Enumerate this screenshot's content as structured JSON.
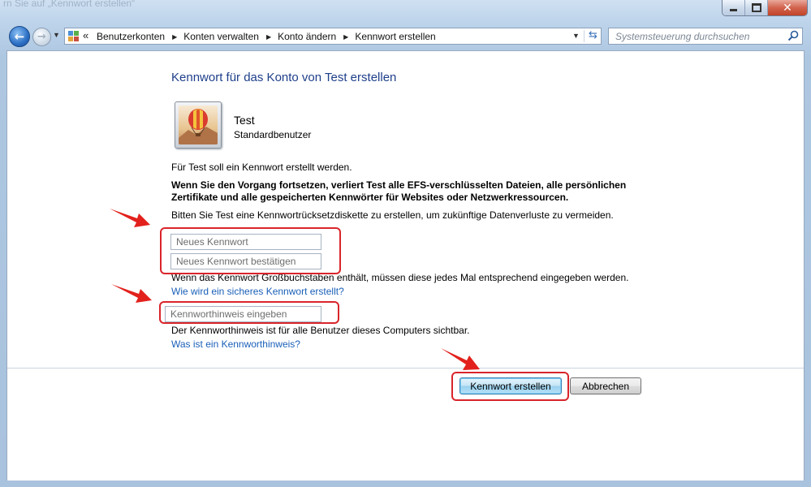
{
  "window": {
    "faint_title": "rn Sie auf „Kennwort erstellen“"
  },
  "nav": {
    "breadcrumbs": [
      "Benutzerkonten",
      "Konten verwalten",
      "Konto ändern",
      "Kennwort erstellen"
    ],
    "overflow_chevron": "«",
    "search_placeholder": "Systemsteuerung durchsuchen"
  },
  "page": {
    "title": "Kennwort für das Konto von Test erstellen",
    "user": {
      "name": "Test",
      "type": "Standardbenutzer"
    },
    "info_line1": "Für Test soll ein Kennwort erstellt werden.",
    "warning_line1": "Wenn Sie den Vorgang fortsetzen, verliert Test alle EFS-verschlüsselten Dateien, alle persönlichen",
    "warning_line2": "Zertifikate und alle gespeicherten Kennwörter für Websites oder Netzwerkressourcen.",
    "info_line2": "Bitten Sie Test eine Kennwortrücksetzdiskette zu erstellen, um zukünftige Datenverluste zu vermeiden.",
    "new_password_placeholder": "Neues Kennwort",
    "confirm_password_placeholder": "Neues Kennwort bestätigen",
    "uppercase_note": "Wenn das Kennwort Großbuchstaben enthält, müssen diese jedes Mal entsprechend eingegeben werden.",
    "secure_password_link": "Wie wird ein sicheres Kennwort erstellt?",
    "hint_placeholder": "Kennworthinweis eingeben",
    "hint_note": "Der Kennworthinweis ist für alle Benutzer dieses Computers sichtbar.",
    "hint_link": "Was ist ein Kennworthinweis?",
    "create_button": "Kennwort erstellen",
    "cancel_button": "Abbrechen"
  },
  "colors": {
    "title_blue": "#1e3f8a",
    "link_blue": "#1a5fb8",
    "highlight_red": "#d9252b"
  }
}
